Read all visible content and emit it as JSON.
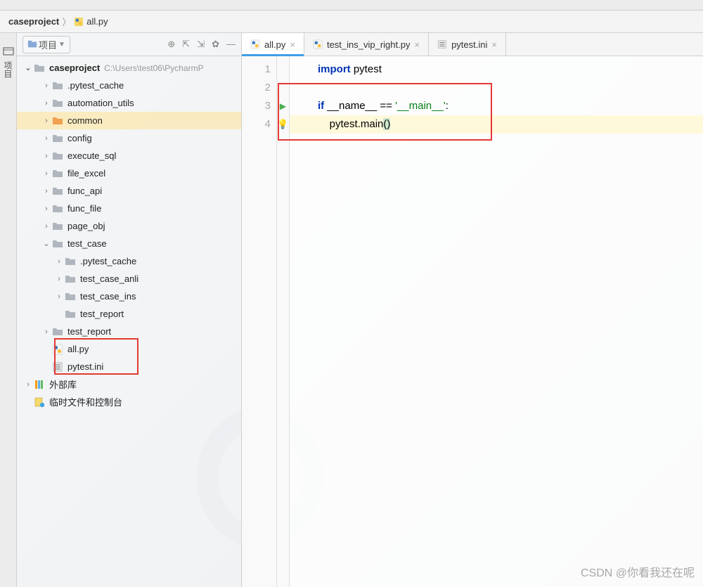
{
  "breadcrumb": {
    "project": "caseproject",
    "file": "all.py"
  },
  "sidebar": {
    "header": {
      "label": "项目"
    },
    "tree": [
      {
        "type": "project",
        "label": "caseproject",
        "path": "C:\\Users\\test06\\PycharmP",
        "lvl": 0,
        "arrow": "down",
        "bold": true
      },
      {
        "type": "folder",
        "label": ".pytest_cache",
        "lvl": 1,
        "arrow": "right"
      },
      {
        "type": "folder",
        "label": "automation_utils",
        "lvl": 1,
        "arrow": "right"
      },
      {
        "type": "folder",
        "label": "common",
        "lvl": 1,
        "arrow": "right",
        "highlight": true,
        "orange": true
      },
      {
        "type": "folder",
        "label": "config",
        "lvl": 1,
        "arrow": "right"
      },
      {
        "type": "folder",
        "label": "execute_sql",
        "lvl": 1,
        "arrow": "right"
      },
      {
        "type": "folder",
        "label": "file_excel",
        "lvl": 1,
        "arrow": "right"
      },
      {
        "type": "folder",
        "label": "func_api",
        "lvl": 1,
        "arrow": "right"
      },
      {
        "type": "folder",
        "label": "func_file",
        "lvl": 1,
        "arrow": "right"
      },
      {
        "type": "folder",
        "label": "page_obj",
        "lvl": 1,
        "arrow": "right"
      },
      {
        "type": "folder",
        "label": "test_case",
        "lvl": 1,
        "arrow": "down"
      },
      {
        "type": "folder",
        "label": ".pytest_cache",
        "lvl": 2,
        "arrow": "right"
      },
      {
        "type": "folder",
        "label": "test_case_anli",
        "lvl": 2,
        "arrow": "right"
      },
      {
        "type": "folder",
        "label": "test_case_ins",
        "lvl": 2,
        "arrow": "right"
      },
      {
        "type": "folder",
        "label": "test_report",
        "lvl": 2,
        "arrow": ""
      },
      {
        "type": "folder",
        "label": "test_report",
        "lvl": 1,
        "arrow": "right",
        "spec": true
      },
      {
        "type": "pyfile",
        "label": "all.py",
        "lvl": 1,
        "arrow": ""
      },
      {
        "type": "inifile",
        "label": "pytest.ini",
        "lvl": 1,
        "arrow": ""
      },
      {
        "type": "extlib",
        "label": "外部库",
        "lvl": -1,
        "arrow": "right"
      },
      {
        "type": "scratch",
        "label": "临时文件和控制台",
        "lvl": -1,
        "arrow": ""
      }
    ]
  },
  "side_tab": {
    "label": "项目"
  },
  "tabs": [
    {
      "label": "all.py",
      "icon": "py",
      "active": true
    },
    {
      "label": "test_ins_vip_right.py",
      "icon": "py",
      "active": false
    },
    {
      "label": "pytest.ini",
      "icon": "ini",
      "active": false
    }
  ],
  "code": {
    "lines": [
      {
        "n": "1",
        "run": "",
        "segs": [
          {
            "c": "kw2",
            "t": "import "
          },
          {
            "c": "ident",
            "t": "pytest"
          }
        ]
      },
      {
        "n": "2",
        "run": "",
        "segs": []
      },
      {
        "n": "3",
        "run": "run",
        "segs": [
          {
            "c": "kw2",
            "t": "if "
          },
          {
            "c": "ident",
            "t": "__name__ == "
          },
          {
            "c": "str",
            "t": "'__main__'"
          },
          {
            "c": "ident",
            "t": ":"
          }
        ]
      },
      {
        "n": "4",
        "run": "bulb",
        "hl": true,
        "segs": [
          {
            "c": "ident",
            "t": "    pytest.main"
          },
          {
            "c": "paren-hl",
            "t": "("
          },
          {
            "c": "paren-hl",
            "t": ")"
          }
        ]
      }
    ]
  },
  "watermark": "CSDN @你看我还在呢"
}
